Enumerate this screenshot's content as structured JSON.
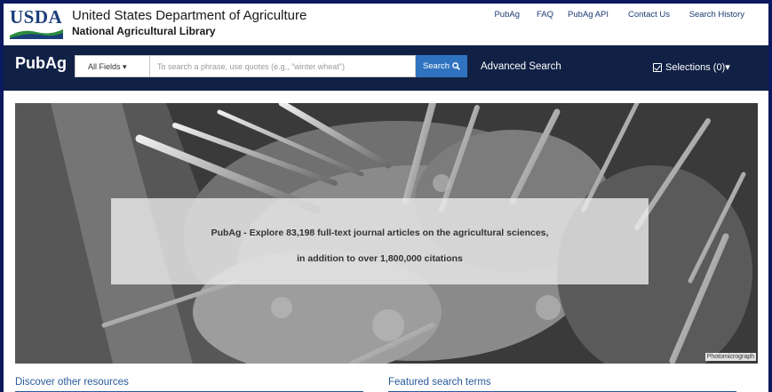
{
  "header": {
    "logo_text": "USDA",
    "department": "United States Department of Agriculture",
    "library": "National Agricultural Library",
    "links": [
      {
        "label": "PubAg"
      },
      {
        "label": "FAQ"
      },
      {
        "label": "PubAg API"
      },
      {
        "label": "Contact Us"
      },
      {
        "label": "Search History"
      }
    ]
  },
  "navbar": {
    "brand": "PubAg",
    "field_select": "All Fields ▾",
    "search_placeholder": "To search a phrase, use quotes (e.g., \"winter wheat\")",
    "search_value": "",
    "search_button": "Search",
    "advanced_search": "Advanced Search",
    "selections": "Selections (0)▾"
  },
  "hero": {
    "line1": "PubAg - Explore 83,198 full-text journal articles on the agricultural sciences,",
    "line2": "in addition to over 1,800,000 citations",
    "photo_credit": "Photomicrograph"
  },
  "sections": {
    "discover": "Discover other resources",
    "featured": "Featured search terms"
  },
  "colors": {
    "page_border": "#0b1a5e",
    "navbar": "#112145",
    "search_button": "#2f73c0",
    "link": "#2a5a9a"
  }
}
